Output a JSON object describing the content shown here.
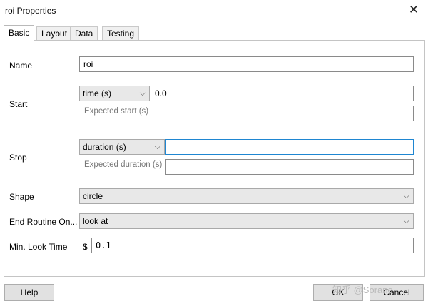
{
  "window": {
    "title": "roi Properties"
  },
  "tabs": [
    {
      "label": "Basic"
    },
    {
      "label": "Layout"
    },
    {
      "label": "Data"
    },
    {
      "label": "Testing"
    }
  ],
  "fields": {
    "name": {
      "label": "Name",
      "value": "roi"
    },
    "start": {
      "label": "Start",
      "type_selected": "time (s)",
      "value": "0.0",
      "expected_label": "Expected start (s)",
      "expected_value": ""
    },
    "stop": {
      "label": "Stop",
      "type_selected": "duration (s)",
      "value": "",
      "expected_label": "Expected duration (s)",
      "expected_value": ""
    },
    "shape": {
      "label": "Shape",
      "selected": "circle"
    },
    "end_routine": {
      "label": "End Routine On...",
      "selected": "look at"
    },
    "min_look_time": {
      "label": "Min. Look Time",
      "prefix": "$",
      "value": "0.1"
    }
  },
  "buttons": {
    "help": "Help",
    "ok": "OK",
    "cancel": "Cancel"
  },
  "watermark": "知乎 @Sorane",
  "icons": {
    "close": "close-icon",
    "dropdown": "chevron-down-icon"
  }
}
